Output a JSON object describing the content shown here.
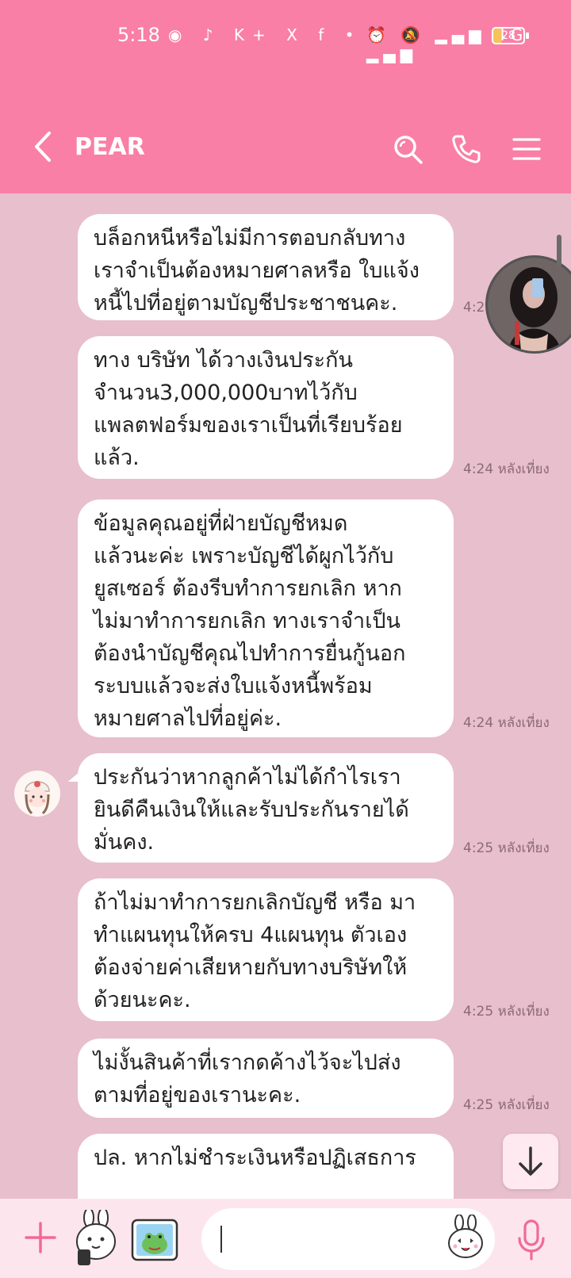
{
  "status_bar": {
    "time": "5:18",
    "icons_left": "◉ ♪ K+ X f •",
    "icons_right": "⏰ 🔕 ▂▄▆ 4G ▂▄▆",
    "battery": "28"
  },
  "header": {
    "title": "PEAR"
  },
  "messages": [
    {
      "text": "บล็อกหนีหรือไม่มีการตอบกลับทาง\nเราจำเป็นต้องหมายศาลหรือ ใบแจ้ง\nหนี้ไปที่อยู่ตามบัญชีประชาชนคะ.",
      "time": "4:2"
    },
    {
      "text": "ทาง บริษัท ได้วางเงินประกัน\nจำนวน3,000,000บาทไว้กับ\nแพลตฟอร์มของเราเป็นที่เรียบร้อย\nแล้ว.",
      "time": "4:24 หลังเที่ยง"
    },
    {
      "text": "ข้อมูลคุณอยู่ที่ฝ่ายบัญชีหมด\nแล้วนะค่ะ เพราะบัญชีได้ผูกไว้กับ\nยูสเซอร์ ต้องรีบทำการยกเลิก หาก\nไม่มาทำการยกเลิก ทางเราจำเป็น\nต้องนำบัญชีคุณไปทำการยื่นกู้นอก\nระบบแล้วจะส่งใบแจ้งหนี้พร้อม\nหมายศาลไปที่อยู่ค่ะ.",
      "time": "4:24 หลังเที่ยง"
    },
    {
      "text": "ประกันว่าหากลูกค้าไม่ได้กำไรเรา\nยินดีคืนเงินให้และรับประกันรายได้\nมั่นคง.",
      "time": "4:25 หลังเที่ยง"
    },
    {
      "text": "ถ้าไม่มาทำการยกเลิกบัญชี หรือ มา\nทำแผนทุนให้ครบ 4แผนทุน ตัวเอง\nต้องจ่ายค่าเสียหายกับทางบริษัทให้\nด้วยนะคะ.",
      "time": "4:25 หลังเที่ยง"
    },
    {
      "text": "ไม่งั้นสินค้าที่เรากดค้างไว้จะไปส่ง\nตามที่อยู่ของเรานะคะ.",
      "time": "4:25 หลังเที่ยง"
    },
    {
      "text": "ปล. หากไม่ชำระเงินหรือปฏิเสธการ",
      "time": ""
    }
  ],
  "input": {
    "placeholder": ""
  },
  "colors": {
    "header": "#f97fa7",
    "chat_bg": "#e8bfcc",
    "bubble": "#ffffff",
    "input_bar": "#fde5ee",
    "accent_icon": "#f06a97"
  },
  "icons": [
    "back-icon",
    "search-icon",
    "phone-icon",
    "menu-icon",
    "plus-icon",
    "sticker-icon",
    "image-icon",
    "emoji-icon",
    "mic-icon",
    "arrow-down-icon"
  ]
}
